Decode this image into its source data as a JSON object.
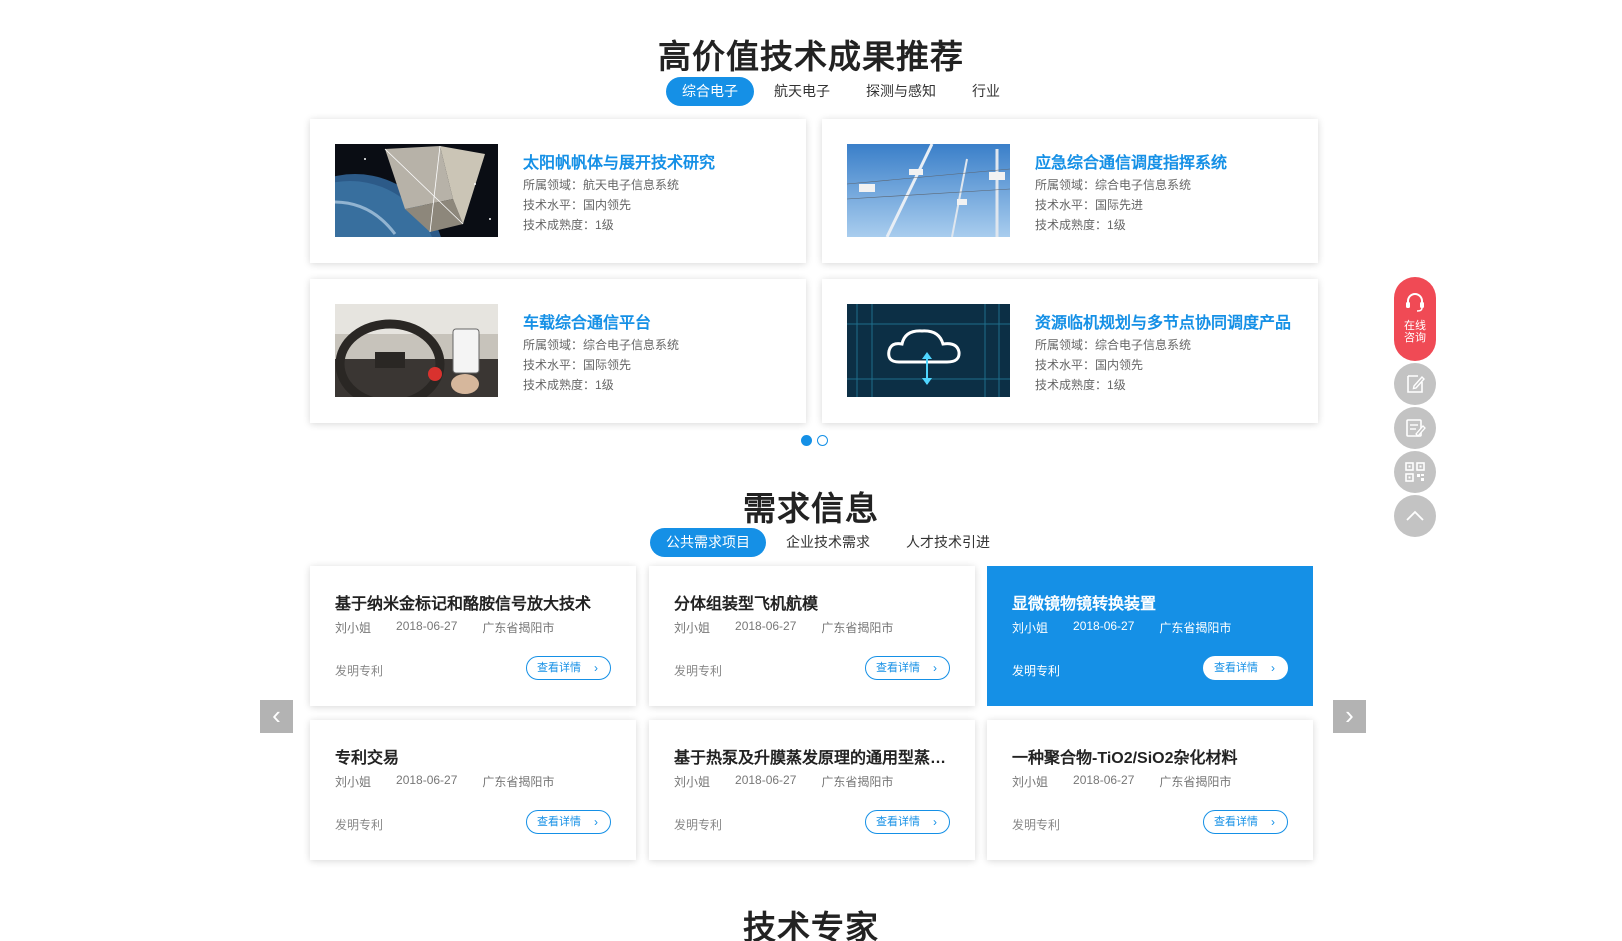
{
  "achievements": {
    "title": "高价值技术成果推荐",
    "tabs": [
      "综合电子",
      "航天电子",
      "探测与感知",
      "行业"
    ],
    "field_label": "所属领域：",
    "level_label": "技术水平：",
    "maturity_label": "技术成熟度：",
    "cards": [
      {
        "title": "太阳帆帆体与展开技术研究",
        "field": "航天电子信息系统",
        "level": "国内领先",
        "maturity": "1级",
        "image": "solar-sail-image"
      },
      {
        "title": "应急综合通信调度指挥系统",
        "field": "综合电子信息系统",
        "level": "国际先进",
        "maturity": "1级",
        "image": "antenna-towers-image"
      },
      {
        "title": "车载综合通信平台",
        "field": "综合电子信息系统",
        "level": "国际领先",
        "maturity": "1级",
        "image": "car-phone-image"
      },
      {
        "title": "资源临机规划与多节点协同调度产品",
        "field": "综合电子信息系统",
        "level": "国内领先",
        "maturity": "1级",
        "image": "cloud-data-image"
      }
    ],
    "pager": {
      "current": 1,
      "total": 2
    }
  },
  "demands": {
    "title": "需求信息",
    "tabs": [
      "公共需求项目",
      "企业技术需求",
      "人才技术引进"
    ],
    "button_label": "查看详情",
    "cards": [
      {
        "title": "基于纳米金标记和酪胺信号放大技术",
        "contact": "刘小姐",
        "date": "2018-06-27",
        "location": "广东省揭阳市",
        "type": "发明专利"
      },
      {
        "title": "分体组装型飞机航模",
        "contact": "刘小姐",
        "date": "2018-06-27",
        "location": "广东省揭阳市",
        "type": "发明专利"
      },
      {
        "title": "显微镜物镜转换装置",
        "contact": "刘小姐",
        "date": "2018-06-27",
        "location": "广东省揭阳市",
        "type": "发明专利",
        "highlight": true
      },
      {
        "title": "专利交易",
        "contact": "刘小姐",
        "date": "2018-06-27",
        "location": "广东省揭阳市",
        "type": "发明专利"
      },
      {
        "title": "基于热泵及升膜蒸发原理的通用型蒸发器",
        "contact": "刘小姐",
        "date": "2018-06-27",
        "location": "广东省揭阳市",
        "type": "发明专利"
      },
      {
        "title": "一种聚合物-TiO2/SiO2杂化材料",
        "contact": "刘小姐",
        "date": "2018-06-27",
        "location": "广东省揭阳市",
        "type": "发明专利"
      }
    ]
  },
  "experts": {
    "title": "技术专家"
  },
  "sidebar": {
    "consult_line1": "在线",
    "consult_line2": "咨询",
    "icons": [
      "headset-icon",
      "edit-icon",
      "form-icon",
      "qrcode-icon",
      "back-to-top-icon"
    ]
  },
  "colors": {
    "accent": "#1590e6",
    "consult": "#f04a55",
    "side_gray": "#c3c3c3"
  }
}
